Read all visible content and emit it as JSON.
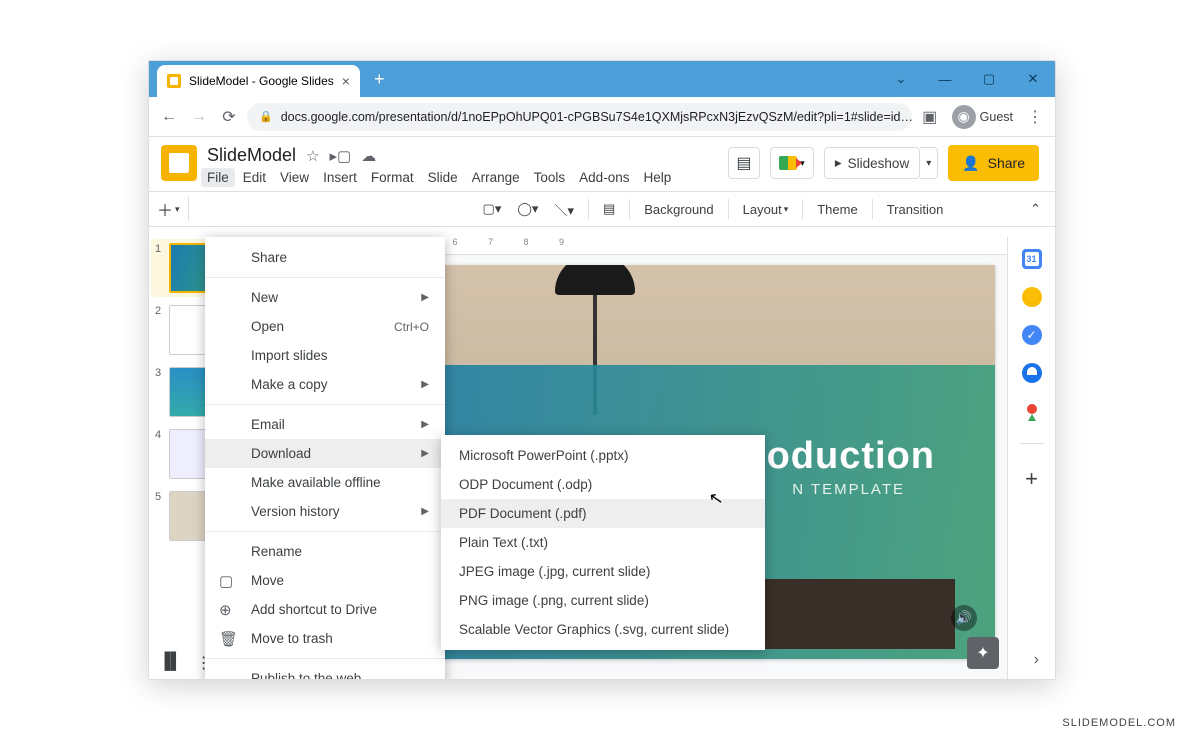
{
  "browser": {
    "tab_title": "SlideModel - Google Slides",
    "url": "docs.google.com/presentation/d/1noEPpOhUPQ01-cPGBSu7S4e1QXMjsRPcxN3jEzvQSzM/edit?pli=1#slide=id…",
    "guest_label": "Guest"
  },
  "app": {
    "doc_title": "SlideModel",
    "slideshow_btn": "Slideshow",
    "share_btn": "Share",
    "menubar": [
      "File",
      "Edit",
      "View",
      "Insert",
      "Format",
      "Slide",
      "Arrange",
      "Tools",
      "Add-ons",
      "Help"
    ],
    "toolbar": {
      "bg": "Background",
      "layout": "Layout",
      "theme": "Theme",
      "transition": "Transition"
    }
  },
  "file_menu": {
    "share": "Share",
    "new": "New",
    "open": "Open",
    "open_sc": "Ctrl+O",
    "import": "Import slides",
    "copy": "Make a copy",
    "email": "Email",
    "download": "Download",
    "offline": "Make available offline",
    "history": "Version history",
    "rename": "Rename",
    "move": "Move",
    "shortcut": "Add shortcut to Drive",
    "trash": "Move to trash",
    "publish": "Publish to the web"
  },
  "download_menu": {
    "pptx": "Microsoft PowerPoint (.pptx)",
    "odp": "ODP Document (.odp)",
    "pdf": "PDF Document (.pdf)",
    "txt": "Plain Text (.txt)",
    "jpg": "JPEG image (.jpg, current slide)",
    "png": "PNG image (.png, current slide)",
    "svg": "Scalable Vector Graphics (.svg, current slide)"
  },
  "slide_content": {
    "title_visible": "troduction",
    "subtitle_visible": "N TEMPLATE"
  },
  "thumbs": [
    "1",
    "2",
    "3",
    "4",
    "5"
  ],
  "watermark": "SLIDEMODEL.COM"
}
